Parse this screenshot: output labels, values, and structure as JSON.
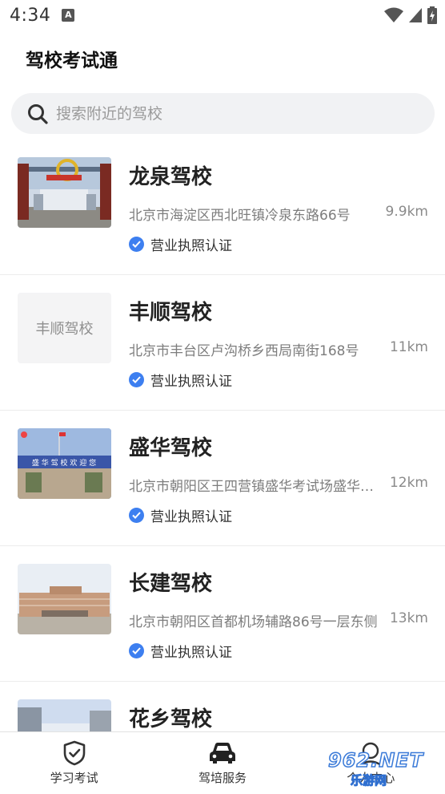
{
  "status_bar": {
    "time": "4:34",
    "notification_icon": "A"
  },
  "app": {
    "title": "驾校考试通"
  },
  "search": {
    "placeholder": "搜索附近的驾校"
  },
  "schools": [
    {
      "name": "龙泉驾校",
      "address": "北京市海淀区西北旺镇冷泉东路66号",
      "distance": "9.9km",
      "cert": "营业执照认证",
      "thumb": "gate-photo"
    },
    {
      "name": "丰顺驾校",
      "address": "北京市丰台区卢沟桥乡西局南街168号",
      "distance": "11km",
      "cert": "营业执照认证",
      "thumb": "text",
      "thumb_text": "丰顺驾校"
    },
    {
      "name": "盛华驾校",
      "address": "北京市朝阳区王四营镇盛华考试场盛华驾校",
      "distance": "12km",
      "cert": "营业执照认证",
      "thumb": "banner-photo",
      "banner_text": "盛 华 驾 校 欢 迎 您"
    },
    {
      "name": "长建驾校",
      "address": "北京市朝阳区首都机场辅路86号一层东侧",
      "distance": "13km",
      "cert": "营业执照认证",
      "thumb": "building-photo"
    },
    {
      "name": "花乡驾校",
      "address": "",
      "distance": "",
      "cert": "",
      "thumb": "building2-photo"
    }
  ],
  "tabbar": [
    {
      "label": "学习考试",
      "icon": "shield-check-icon"
    },
    {
      "label": "驾培服务",
      "icon": "car-icon"
    },
    {
      "label": "个人中心",
      "icon": "person-icon"
    }
  ],
  "watermark": {
    "top": "962.NET",
    "bottom": "乐游网"
  },
  "colors": {
    "accent": "#3d7ff0",
    "search_bg": "#f1f2f4"
  }
}
